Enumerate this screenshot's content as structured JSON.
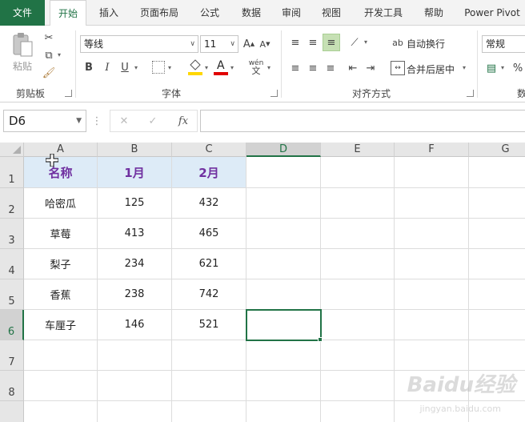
{
  "ribbon_tabs": [
    {
      "label": "文件"
    },
    {
      "label": "开始"
    },
    {
      "label": "插入"
    },
    {
      "label": "页面布局"
    },
    {
      "label": "公式"
    },
    {
      "label": "数据"
    },
    {
      "label": "审阅"
    },
    {
      "label": "视图"
    },
    {
      "label": "开发工具"
    },
    {
      "label": "帮助"
    },
    {
      "label": "Power Pivot"
    }
  ],
  "clipboard": {
    "paste_label": "粘贴",
    "group_label": "剪贴板"
  },
  "font": {
    "name": "等线",
    "size": "11",
    "bold": "B",
    "italic": "I",
    "underline": "U",
    "phonetic": "wén",
    "group_label": "字体",
    "increase": "A",
    "decrease": "A",
    "color_letter": "A",
    "highlight_color": "#ffd700",
    "font_color": "#e00000"
  },
  "alignment": {
    "wrap_label": "自动换行",
    "merge_label": "合并后居中",
    "group_label": "对齐方式"
  },
  "number": {
    "format": "常规",
    "percent": "%",
    "group_label": "数"
  },
  "formula_bar": {
    "name_box": "D6",
    "cancel": "✕",
    "enter": "✓",
    "fx": "fx",
    "value": ""
  },
  "columns": [
    "A",
    "B",
    "C",
    "D",
    "E",
    "F",
    "G"
  ],
  "rows": [
    "1",
    "2",
    "3",
    "4",
    "5",
    "6",
    "7",
    "8"
  ],
  "table": {
    "header": [
      "名称",
      "1月",
      "2月"
    ],
    "rows": [
      [
        "哈密瓜",
        "125",
        "432"
      ],
      [
        "草莓",
        "413",
        "465"
      ],
      [
        "梨子",
        "234",
        "621"
      ],
      [
        "香蕉",
        "238",
        "742"
      ],
      [
        "车厘子",
        "146",
        "521"
      ]
    ]
  },
  "selected_cell": "D6",
  "watermark": {
    "text": "Baidu经验",
    "sub": "jingyan.baidu.com"
  },
  "colors": {
    "accent": "#217346",
    "header_fill": "#ddebf7",
    "header_text": "#7030a0"
  }
}
